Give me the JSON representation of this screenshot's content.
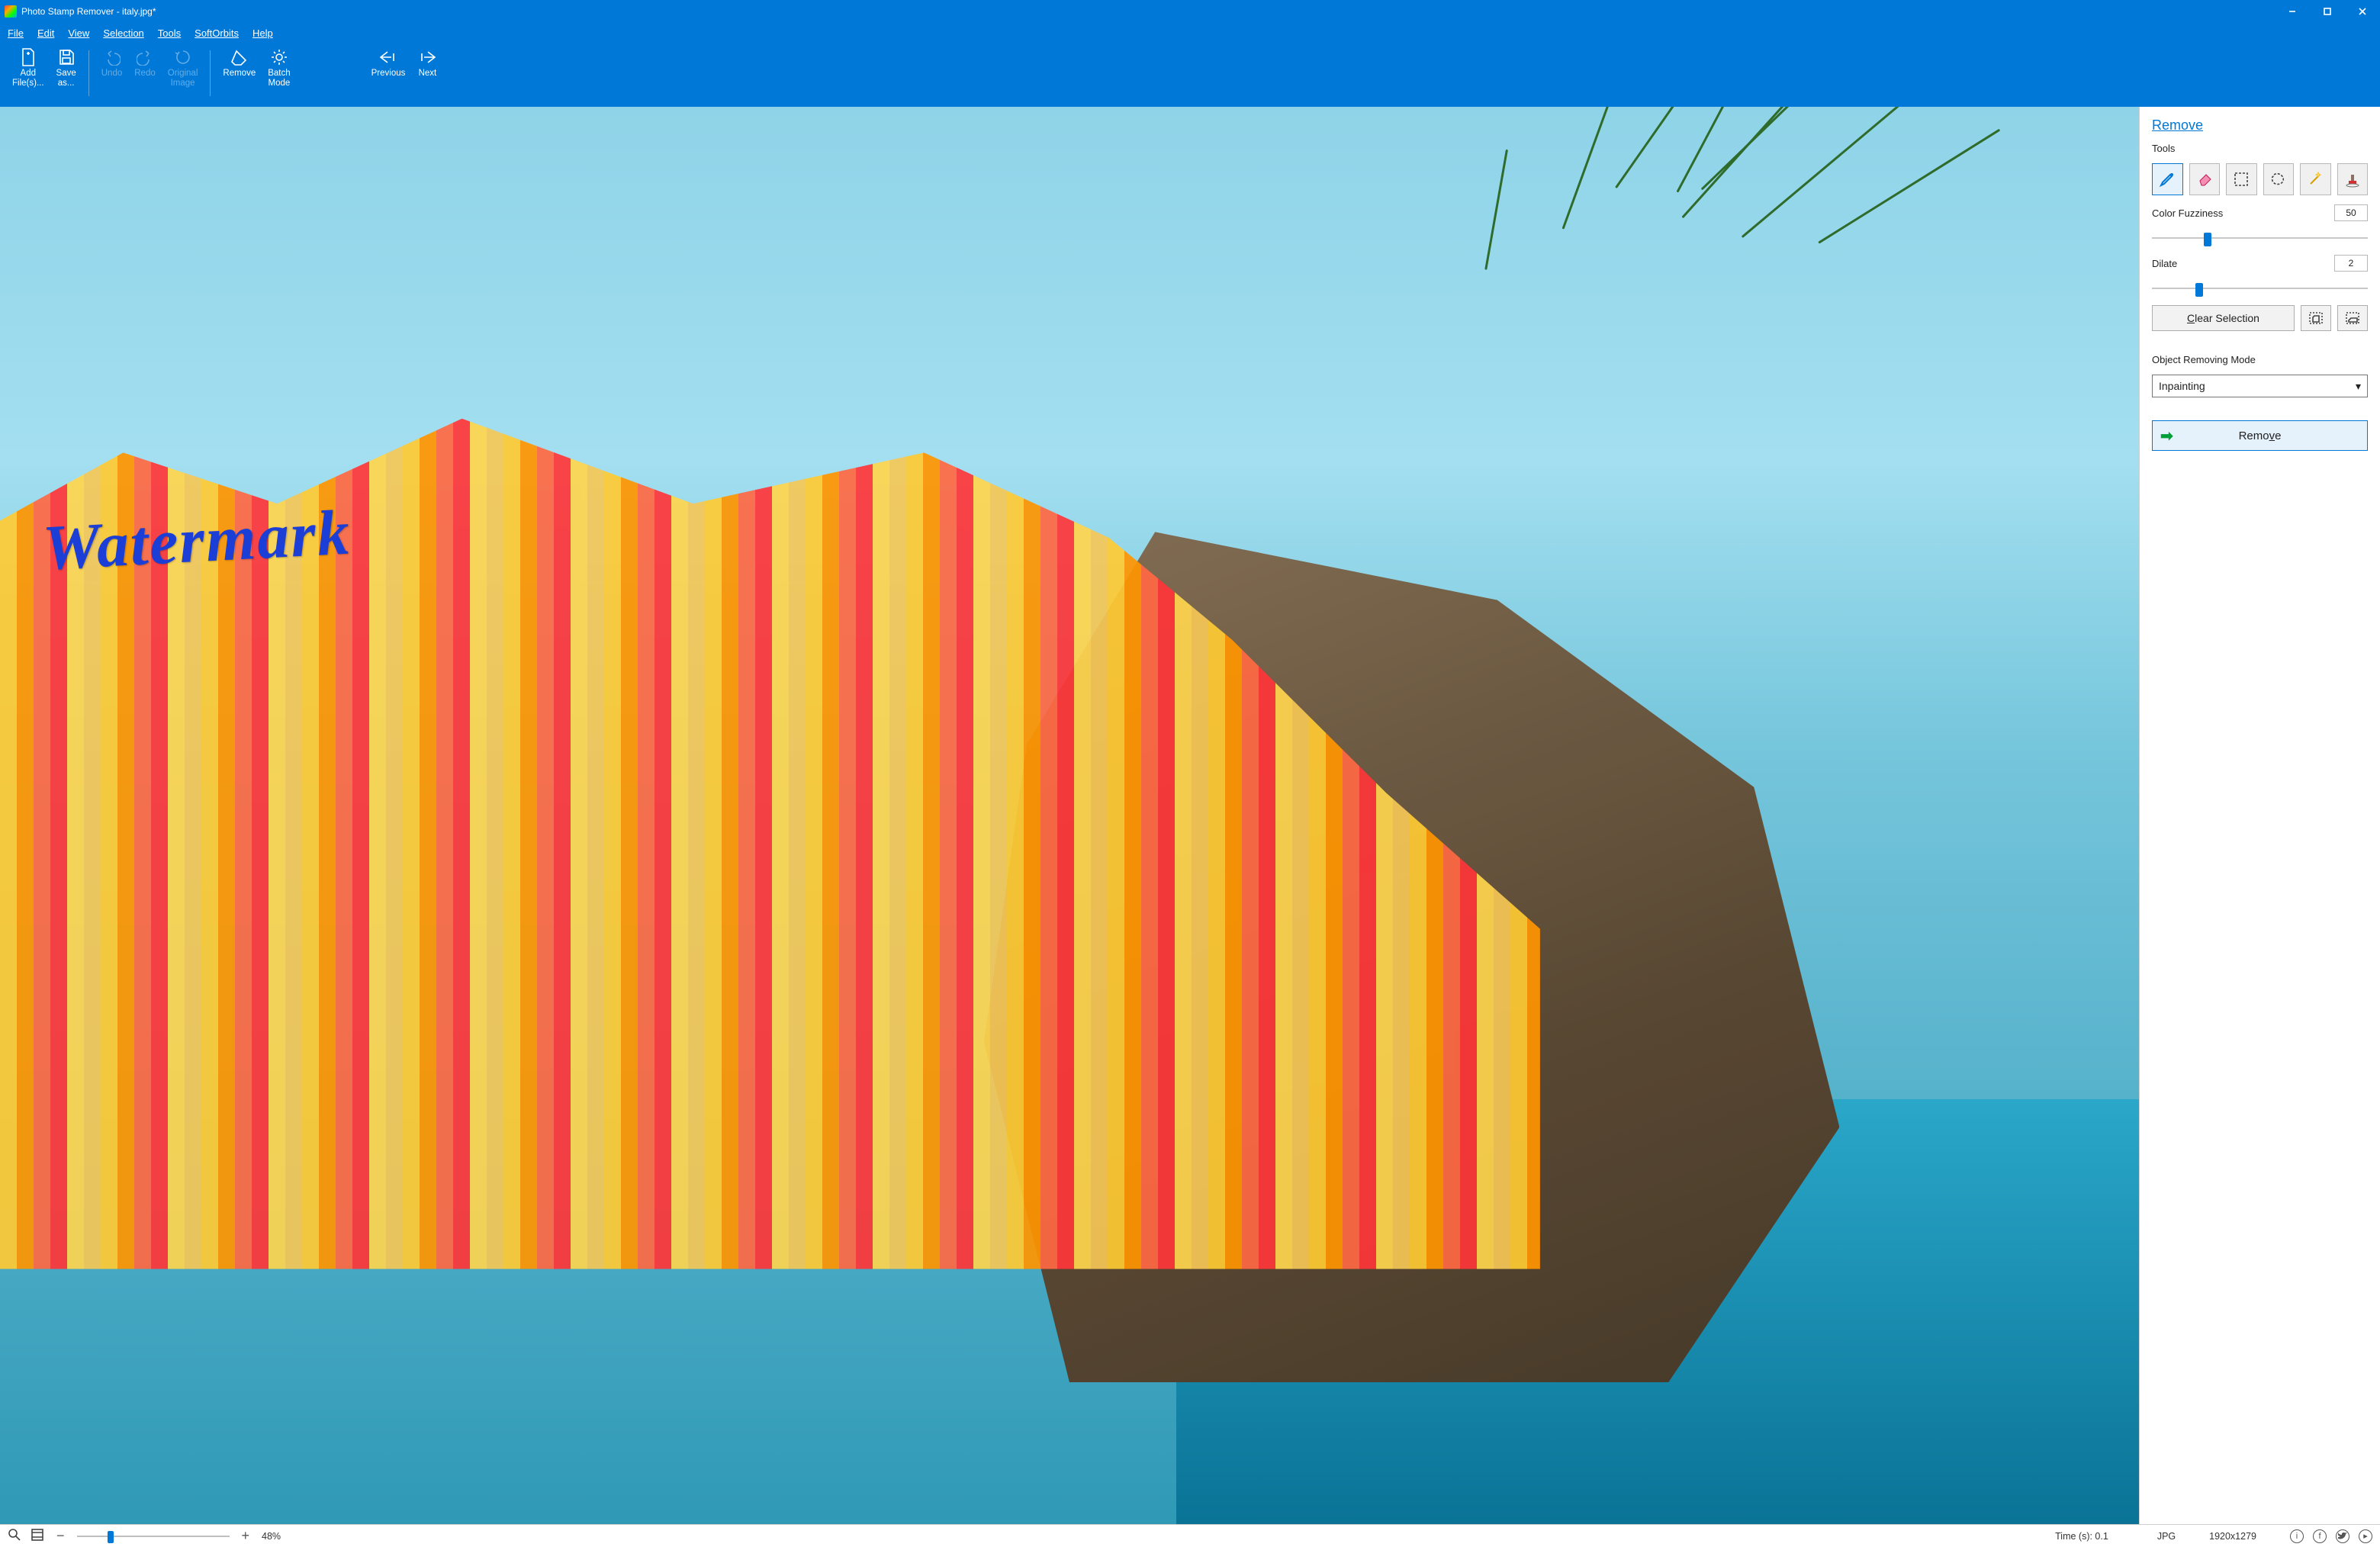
{
  "titlebar": {
    "title": "Photo Stamp Remover - italy.jpg*"
  },
  "menu": {
    "file": "File",
    "edit": "Edit",
    "view": "View",
    "selection": "Selection",
    "tools": "Tools",
    "softorbits": "SoftOrbits",
    "help": "Help"
  },
  "toolbar": {
    "add_files": "Add\nFile(s)...",
    "save_as": "Save\nas...",
    "undo": "Undo",
    "redo": "Redo",
    "original": "Original\nImage",
    "remove": "Remove",
    "batch": "Batch\nMode",
    "previous": "Previous",
    "next": "Next"
  },
  "canvas": {
    "watermark_text": "Watermark"
  },
  "panel": {
    "title": "Remove",
    "tools_label": "Tools",
    "color_fuzziness_label": "Color Fuzziness",
    "color_fuzziness_value": "50",
    "dilate_label": "Dilate",
    "dilate_value": "2",
    "clear_selection": "Clear Selection",
    "object_mode_label": "Object Removing Mode",
    "object_mode_value": "Inpainting",
    "remove_button": "Remove"
  },
  "statusbar": {
    "zoom_pct": "48%",
    "time_label": "Time (s): 0.1",
    "format": "JPG",
    "dimensions": "1920x1279"
  }
}
